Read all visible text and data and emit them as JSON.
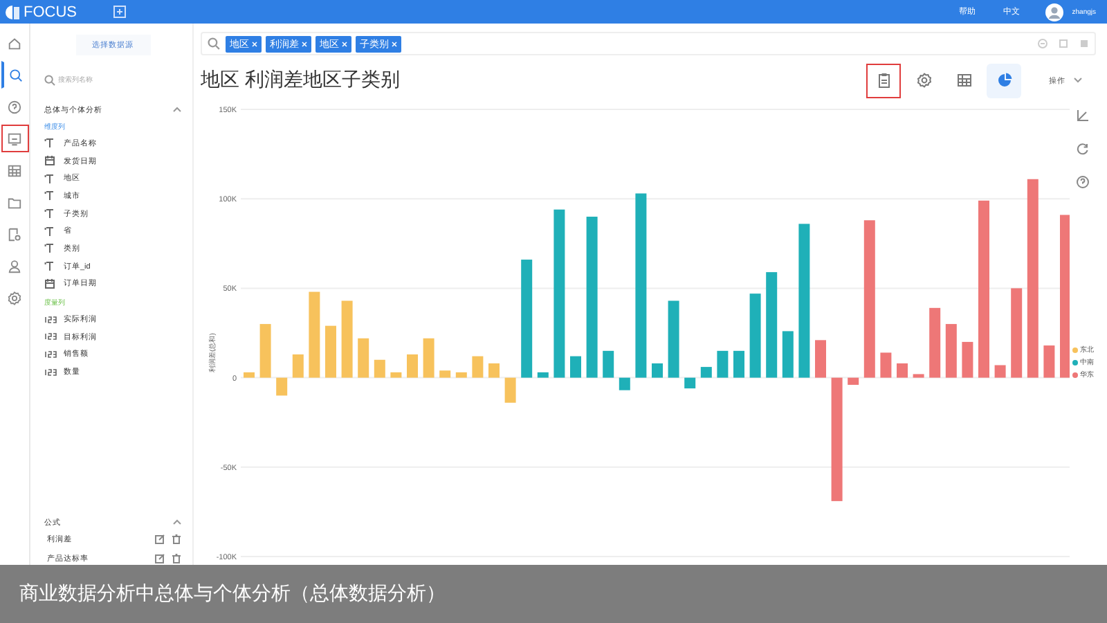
{
  "top_bar": {
    "logo": "FOCUS",
    "links": [
      "帮助",
      "中文"
    ],
    "user": "zhangjs"
  },
  "nav_rail": [
    {
      "selected": false,
      "highlighted": false
    },
    {
      "selected": true,
      "highlighted": false
    },
    {
      "selected": false,
      "highlighted": false
    },
    {
      "selected": false,
      "highlighted": true
    },
    {
      "selected": false,
      "highlighted": false
    },
    {
      "selected": false,
      "highlighted": false
    },
    {
      "selected": false,
      "highlighted": false
    },
    {
      "selected": false,
      "highlighted": false
    },
    {
      "selected": false,
      "highlighted": false
    }
  ],
  "sidebar": {
    "source_button": "选择数据源",
    "search": {
      "placeholder": "搜索列名称"
    },
    "section": {
      "title": "总体与个体分析",
      "expanded": true,
      "groups": [
        {
          "label": "维度列",
          "kind": "dimension",
          "items": [
            {
              "label": "产品名称",
              "kind": "text"
            },
            {
              "label": "发货日期",
              "kind": "date"
            },
            {
              "label": "地区",
              "kind": "text"
            },
            {
              "label": "城市",
              "kind": "text"
            },
            {
              "label": "子类别",
              "kind": "text"
            },
            {
              "label": "省",
              "kind": "text"
            },
            {
              "label": "类别",
              "kind": "text"
            },
            {
              "label": "订单_id",
              "kind": "text"
            },
            {
              "label": "订单日期",
              "kind": "date"
            }
          ]
        },
        {
          "label": "度量列",
          "kind": "measure",
          "items": [
            {
              "label": "实际利润",
              "kind": "number"
            },
            {
              "label": "目标利润",
              "kind": "number"
            },
            {
              "label": "销售额",
              "kind": "number"
            },
            {
              "label": "数量",
              "kind": "number"
            }
          ]
        }
      ]
    },
    "formulas": {
      "title": "公式",
      "expanded": true,
      "items": [
        "利润差",
        "产品达标率"
      ]
    }
  },
  "search_bar": {
    "tokens": [
      "地区",
      "利润差",
      "地区",
      "子类别"
    ]
  },
  "title": "地区 利润差地区子类别",
  "toolbar": {
    "views": [
      {
        "selected": false,
        "highlighted": true
      },
      {
        "selected": false,
        "highlighted": false
      },
      {
        "selected": false,
        "highlighted": false
      },
      {
        "selected": true,
        "highlighted": false
      }
    ],
    "menu": "操作"
  },
  "chart_data": {
    "type": "bar",
    "ylabel": "利润差(总和)",
    "ylim": [
      -100000,
      150000
    ],
    "grid": true,
    "yticks": [
      {
        "value": 150000,
        "label": "150K"
      },
      {
        "value": 100000,
        "label": "100K"
      },
      {
        "value": 50000,
        "label": "50K"
      },
      {
        "value": 0,
        "label": "0"
      },
      {
        "value": -50000,
        "label": "-50K"
      },
      {
        "value": -100000,
        "label": "-100K"
      }
    ],
    "series": [
      {
        "name": "东北",
        "color": "#f7c25c",
        "values": [
          3000,
          30000,
          -10000,
          13000,
          48000,
          29000,
          43000,
          22000,
          10000,
          3000,
          13000,
          22000,
          4000,
          3000,
          12000,
          8000,
          -14000,
          null,
          null,
          null,
          null,
          null,
          null,
          null,
          null,
          null,
          null,
          null,
          null,
          null,
          null,
          null,
          null,
          null,
          null,
          null,
          null,
          null,
          null,
          null,
          null,
          null,
          null,
          null,
          null,
          null,
          null,
          null,
          null,
          null,
          null
        ]
      },
      {
        "name": "中南",
        "color": "#1fb0b8",
        "values": [
          null,
          null,
          null,
          null,
          null,
          null,
          null,
          null,
          null,
          null,
          null,
          null,
          null,
          null,
          null,
          null,
          null,
          66000,
          3000,
          94000,
          12000,
          90000,
          15000,
          -7000,
          103000,
          8000,
          43000,
          -6000,
          6000,
          15000,
          15000,
          47000,
          59000,
          26000,
          86000,
          null,
          null,
          null,
          null,
          null,
          null,
          null,
          null,
          null,
          null,
          null,
          null,
          null,
          null,
          null,
          null
        ]
      },
      {
        "name": "华东",
        "color": "#ee7777",
        "values": [
          null,
          null,
          null,
          null,
          null,
          null,
          null,
          null,
          null,
          null,
          null,
          null,
          null,
          null,
          null,
          null,
          null,
          null,
          null,
          null,
          null,
          null,
          null,
          null,
          null,
          null,
          null,
          null,
          null,
          null,
          null,
          null,
          null,
          null,
          null,
          21000,
          -69000,
          -4000,
          88000,
          14000,
          8000,
          2000,
          39000,
          30000,
          20000,
          99000,
          7000,
          50000,
          111000,
          18000,
          91000
        ]
      }
    ]
  },
  "caption": "商业数据分析中总体与个体分析（总体数据分析）"
}
